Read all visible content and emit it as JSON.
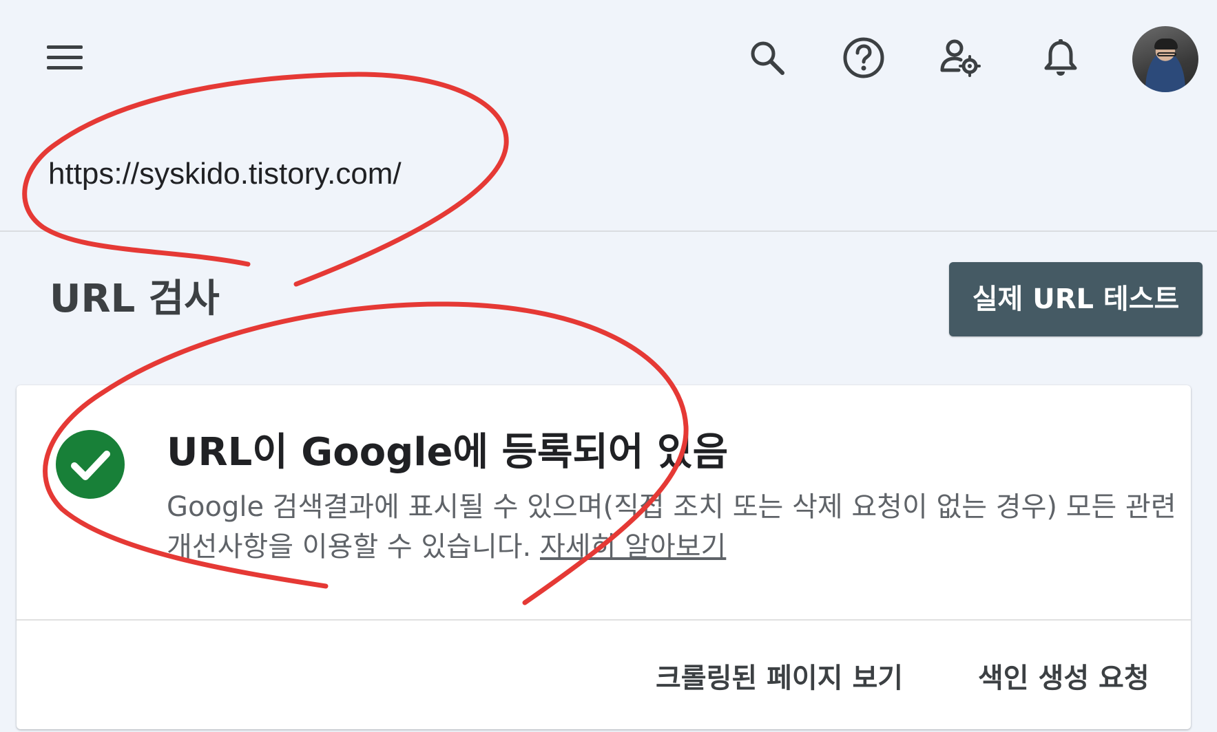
{
  "topbar": {
    "menu_icon": "hamburger-menu-icon",
    "icons": [
      "search-icon",
      "help-icon",
      "manage-users-icon",
      "notifications-bell-icon"
    ],
    "avatar": "user-avatar"
  },
  "property": {
    "url": "https://syskido.tistory.com/"
  },
  "inspection": {
    "title": "URL 검사",
    "test_live_label": "실제 URL 테스트"
  },
  "result": {
    "status_icon": "check-circle-icon",
    "status_color": "#188038",
    "title": "URL이 Google에 등록되어 있음",
    "description": "Google 검색결과에 표시될 수 있으며(직접 조치 또는 삭제 요청이 없는 경우) 모든 관련 개선사항을 이용할 수 있습니다.",
    "learn_more": "자세히 알아보기",
    "view_crawled_label": "크롤링된 페이지 보기",
    "request_indexing_label": "색인 생성 요청"
  },
  "colors": {
    "background": "#f0f4fa",
    "primary_button": "#455a64",
    "annotation_pen": "#e53935"
  }
}
